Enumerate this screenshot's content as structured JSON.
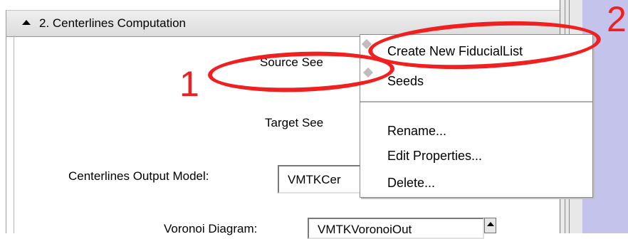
{
  "section": {
    "title": "2. Centerlines Computation"
  },
  "fields": {
    "source_label": "Source See",
    "target_label": "Target See",
    "output_label": "Centerlines Output Model:",
    "output_value": "VMTKCer",
    "voronoi_label": "Voronoi Diagram:",
    "voronoi_value": "VMTKVoronoiOut"
  },
  "context_menu": {
    "items": [
      {
        "label": "Create New FiducialList"
      },
      {
        "label": "Seeds"
      },
      {
        "label": "Rename..."
      },
      {
        "label": "Edit Properties..."
      },
      {
        "label": "Delete..."
      }
    ]
  },
  "annotations": {
    "marker_1": "1",
    "marker_2": "2",
    "color": "#f02020"
  },
  "colors": {
    "side_bar": "#c3c3ec",
    "header_bg": "#e6e6e6"
  }
}
